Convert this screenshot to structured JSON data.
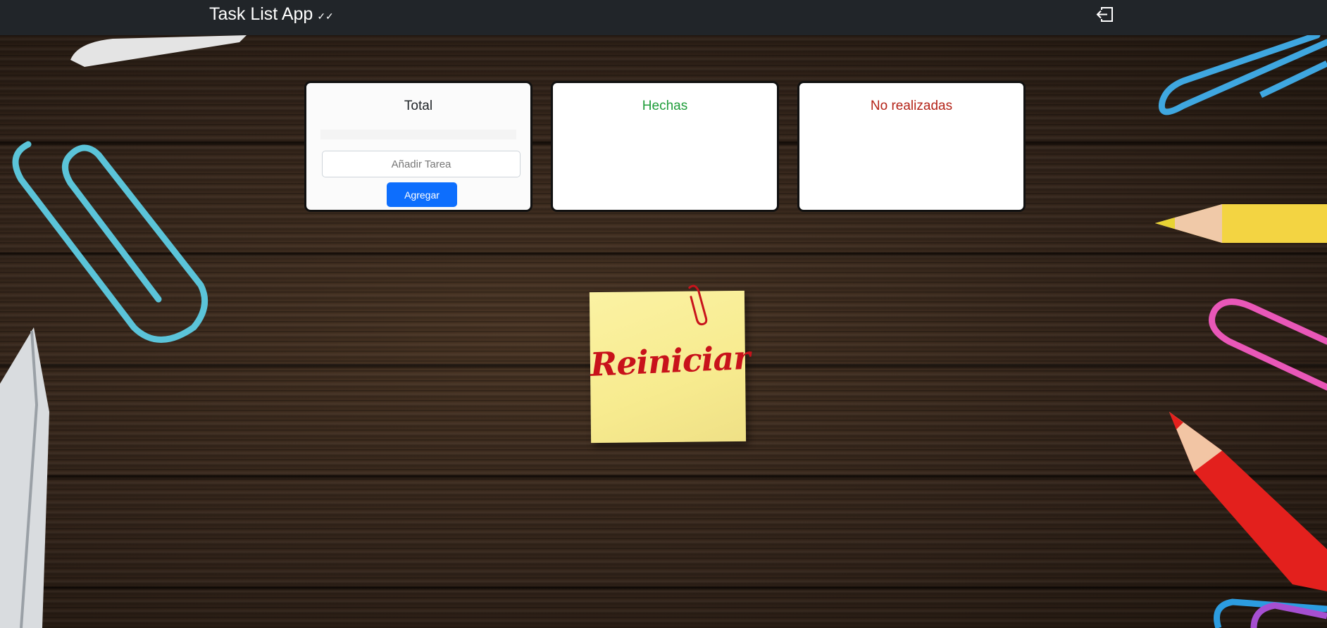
{
  "navbar": {
    "title": "Task List App",
    "title_check": "✓✓"
  },
  "cards": {
    "total": {
      "title": "Total"
    },
    "hechas": {
      "title": "Hechas"
    },
    "no_realizadas": {
      "title": "No realizadas"
    }
  },
  "task_form": {
    "placeholder": "Añadir Tarea",
    "add_label": "Agregar"
  },
  "reset_note": {
    "label": "Reiniciar"
  },
  "colors": {
    "navbar": "#212529",
    "primary": "#0d6efd",
    "done": "#1f9d3a",
    "not_done": "#b42318",
    "note": "#f7eb8f",
    "note_text": "#c8121b"
  }
}
